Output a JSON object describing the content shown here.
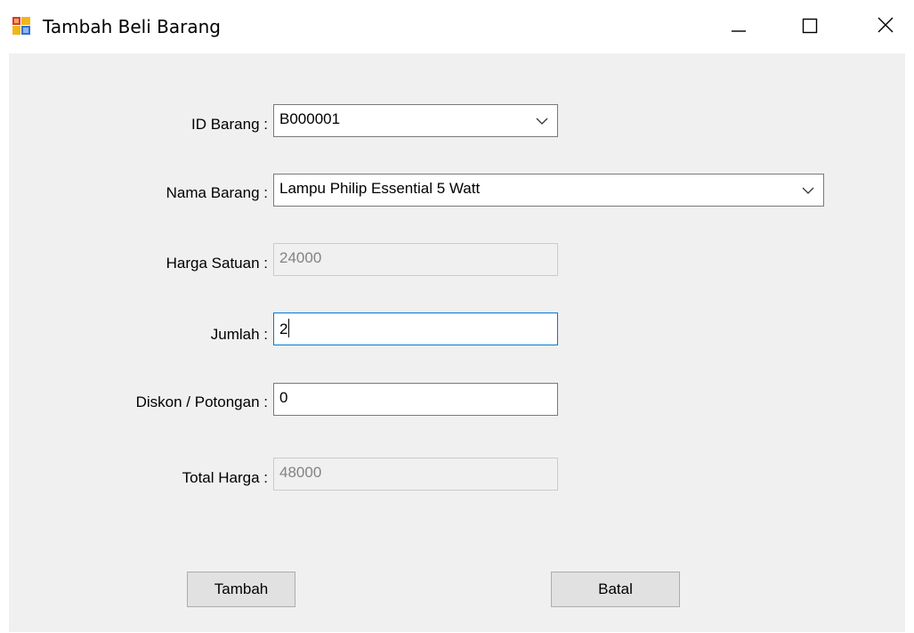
{
  "window": {
    "title": "Tambah Beli Barang",
    "icon": "app-form-icon",
    "controls": [
      "minimize-icon",
      "maximize-icon",
      "close-icon"
    ]
  },
  "form": {
    "id_barang": {
      "label": "ID Barang :",
      "value": "B000001"
    },
    "nama_barang": {
      "label": "Nama Barang :",
      "value": "Lampu Philip Essential 5 Watt"
    },
    "harga_satuan": {
      "label": "Harga Satuan :",
      "value": "24000"
    },
    "jumlah": {
      "label": "Jumlah :",
      "value": "2"
    },
    "diskon": {
      "label": "Diskon / Potongan :",
      "value": "0"
    },
    "total_harga": {
      "label": "Total Harga  :",
      "value": "48000"
    }
  },
  "buttons": {
    "tambah": "Tambah",
    "batal": "Batal"
  },
  "colors": {
    "client_bg": "#f0f0f0",
    "focus_border": "#0078d7",
    "disabled_text": "#838383"
  }
}
